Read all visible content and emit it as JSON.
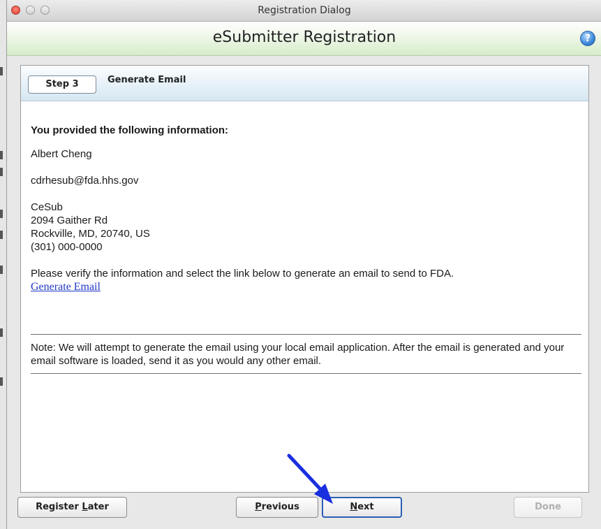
{
  "window": {
    "title": "Registration Dialog"
  },
  "header": {
    "title": "eSubmitter Registration",
    "help_icon": "?"
  },
  "step": {
    "label": "Step 3",
    "title": "Generate Email"
  },
  "info": {
    "heading": "You provided the following information:",
    "name": "Albert Cheng",
    "email": "cdrhesub@fda.hhs.gov",
    "company": "CeSub",
    "address1": "2094 Gaither Rd",
    "address2": "Rockville, MD, 20740, US",
    "phone": "(301) 000-0000"
  },
  "instructions": "Please verify the information and select the link below to generate an email to send to FDA.",
  "generate_link": "Generate Email",
  "note": "Note: We will attempt to generate the email using your local email application. After the email is generated and your email software is loaded, send it as you would any other email.",
  "buttons": {
    "register_later_pre": "Register ",
    "register_later_mnemonic": "L",
    "register_later_post": "ater",
    "previous_mnemonic": "P",
    "previous_rest": "revious",
    "next_mnemonic": "N",
    "next_rest": "ext",
    "done": "Done"
  },
  "colors": {
    "arrow": "#1a2fe0",
    "link": "#2037c6",
    "focus": "#2a5fb4"
  }
}
